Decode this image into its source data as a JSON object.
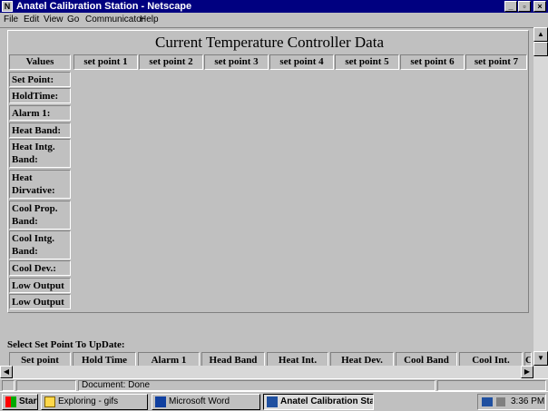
{
  "window": {
    "title": "Anatel Calibration Station - Netscape"
  },
  "menu": [
    "File",
    "Edit",
    "View",
    "Go",
    "Communicator",
    "Help"
  ],
  "page": {
    "title": "Current Temperature Controller Data",
    "values_header": "Values",
    "columns": [
      "set point 1",
      "set point 2",
      "set point 3",
      "set point 4",
      "set point 5",
      "set point 6",
      "set point 7"
    ],
    "rows": [
      "Set Point:",
      "HoldTime:",
      "Alarm 1:",
      "Heat Band:",
      "Heat Intg. Band:",
      "Heat Dirvative:",
      "Cool Prop. Band:",
      "Cool Intg. Band:",
      "Cool Dev.:",
      "Low Output",
      "Low Output"
    ],
    "select_label": "Select Set Point To UpDate:",
    "bottom_columns": [
      "Set point",
      "Hold Time",
      "Alarm 1",
      "Head Band",
      "Heat Int.",
      "Heat Dev.",
      "Cool Band",
      "Cool Int.",
      "C"
    ]
  },
  "status": {
    "text": "Document: Done"
  },
  "taskbar": {
    "start": "Start",
    "tasks": [
      "Exploring - gifs",
      "Microsoft Word",
      "Anatel Calibration Sta..."
    ],
    "time": "3:36 PM"
  },
  "icons": {
    "app": "netscape-icon",
    "minimize": "minimize-icon",
    "maximize": "maximize-icon",
    "close": "close-icon",
    "scroll_up": "arrow-up-icon",
    "scroll_down": "arrow-down-icon",
    "scroll_left": "arrow-left-icon",
    "scroll_right": "arrow-right-icon",
    "start": "windows-flag-icon",
    "explorer": "folder-icon",
    "word": "word-icon"
  },
  "colors": {
    "titlebar": "#000080",
    "face": "#c0c0c0"
  }
}
